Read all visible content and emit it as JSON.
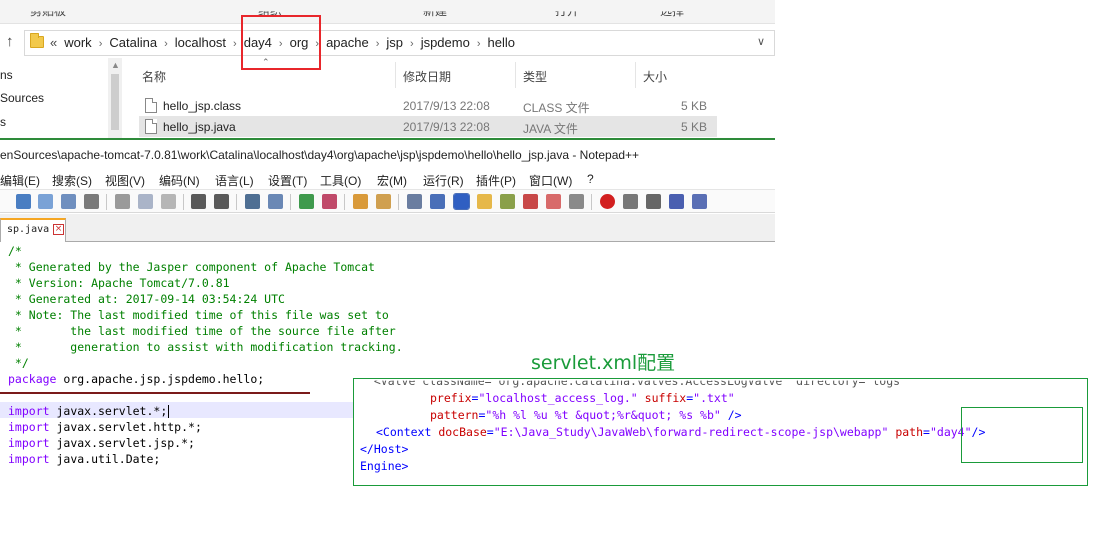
{
  "explorer": {
    "toolbar_partial": [
      "剪贴板",
      "组织",
      "新建",
      "打开",
      "选择"
    ],
    "breadcrumb": [
      "«",
      "work",
      "Catalina",
      "localhost",
      "day4",
      "org",
      "apache",
      "jsp",
      "jspdemo",
      "hello"
    ],
    "nav_items": [
      "ns",
      "Sources",
      "s"
    ],
    "columns": {
      "name": "名称",
      "modified": "修改日期",
      "type": "类型",
      "size": "大小"
    },
    "files": [
      {
        "name": "hello_jsp.class",
        "modified": "2017/9/13 22:08",
        "type": "CLASS 文件",
        "size": "5 KB",
        "selected": false
      },
      {
        "name": "hello_jsp.java",
        "modified": "2017/9/13 22:08",
        "type": "JAVA 文件",
        "size": "5 KB",
        "selected": true
      }
    ]
  },
  "notepad": {
    "title": "enSources\\apache-tomcat-7.0.81\\work\\Catalina\\localhost\\day4\\org\\apache\\jsp\\jspdemo\\hello\\hello_jsp.java - Notepad++",
    "menu": [
      "编辑(E)",
      "搜索(S)",
      "视图(V)",
      "编码(N)",
      "语言(L)",
      "设置(T)",
      "工具(O)",
      "宏(M)",
      "运行(R)",
      "插件(P)",
      "窗口(W)",
      "?"
    ],
    "tab_label": "sp.java",
    "tab_close": "×",
    "code": {
      "comment_lines": [
        "/*",
        " * Generated by the Jasper component of Apache Tomcat",
        " * Version: Apache Tomcat/7.0.81",
        " * Generated at: 2017-09-14 03:54:24 UTC",
        " * Note: The last modified time of this file was set to",
        " *       the last modified time of the source file after",
        " *       generation to assist with modification tracking.",
        " */"
      ],
      "package_kw": "package",
      "package_name": " org.apache.jsp.jspdemo.hello;",
      "imports": [
        {
          "kw": "import",
          "name": " javax.servlet.*;"
        },
        {
          "kw": "import",
          "name": " javax.servlet.http.*;"
        },
        {
          "kw": "import",
          "name": " javax.servlet.jsp.*;"
        },
        {
          "kw": "import",
          "name": " java.util.Date;"
        }
      ]
    }
  },
  "annotation": {
    "label": "servlet.xml配置",
    "xml": {
      "clipped_line": "  <Valve className=\"org.apache.catalina.valves.AccessLogValve\" directory=\"logs\"",
      "prefix_attr": "prefix",
      "prefix_val": "\"localhost_access_log.\"",
      "suffix_attr": "suffix",
      "suffix_val": "\".txt\"",
      "pattern_attr": "pattern",
      "pattern_val": "\"%h %l %u %t &quot;%r&quot; %s %b\"",
      "pattern_end": " />",
      "context_open": "<Context",
      "docbase_attr": "docBase",
      "docbase_val": "\"E:\\Java_Study\\JavaWeb\\forward-redirect-scope-jsp\\webapp\"",
      "path_attr": "path",
      "path_val": "\"day4\"",
      "context_end": "/>",
      "host_close": "</Host>",
      "engine_close": "Engine>"
    }
  },
  "colors": {
    "highlight_red": "#e8262b",
    "annotation_green": "#1a9b3a",
    "comment": "#008000",
    "keyword": "#8000ff"
  }
}
